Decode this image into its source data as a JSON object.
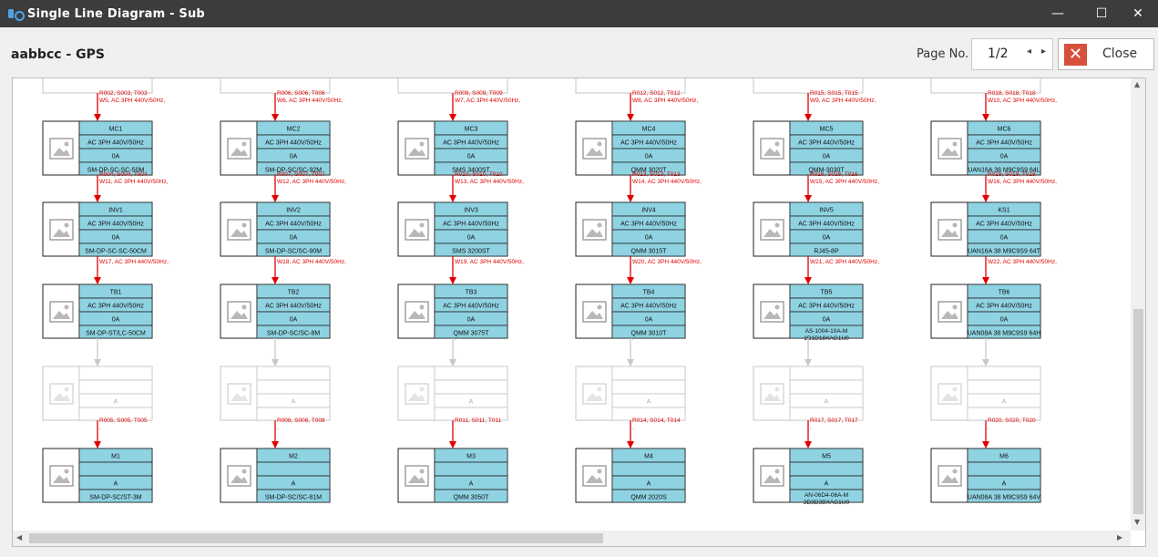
{
  "window": {
    "title": "Single Line Diagram - Sub",
    "minimize_glyph": "—",
    "maximize_glyph": "☐",
    "close_glyph": "✕"
  },
  "header": {
    "title": "aabbcc - GPS",
    "page_label": "Page No.",
    "page_value": "1/2",
    "prev_glyph": "◂",
    "next_glyph": "▸",
    "close_label": "Close"
  },
  "icons": {
    "app": "diagram-app-icon",
    "placeholder": "image-placeholder-icon",
    "close": "close-x-icon"
  },
  "colors": {
    "cell": "#8fd3e2",
    "arrow_active": "#e00000",
    "arrow_inactive": "#c8c8c8",
    "close_accent": "#d7503c"
  },
  "columns": [
    {
      "top_stub": "",
      "rows": [
        {
          "link": [
            "R002, S003, T003",
            "W5, AC 3PH 440V/50Hz,"
          ],
          "name": "MC1",
          "cells": [
            "AC 3PH 440V/50Hz",
            "0A",
            "SM-DP-SC-SC-50M"
          ]
        },
        {
          "link": [
            "R004, S004, T004",
            "W11, AC 3PH 440V/50Hz,"
          ],
          "name": "INV1",
          "cells": [
            "AC 3PH 440V/50Hz",
            "0A",
            "SM-DP-SC-SC-50CM"
          ]
        },
        {
          "link": [
            "W17, AC 3PH 440V/50Hz,"
          ],
          "name": "TB1",
          "cells": [
            "AC 3PH 440V/50Hz",
            "0A",
            "SM-DP-ST/LC-50CM"
          ]
        },
        {
          "inactive": true,
          "link": [
            "."
          ],
          "name": "",
          "cells": [
            "",
            "A",
            ""
          ]
        },
        {
          "link": [
            "R005, S005, T005",
            "."
          ],
          "name": "M1",
          "cells": [
            "",
            "A",
            "SM-DP-SC/ST-3M"
          ]
        }
      ]
    },
    {
      "rows": [
        {
          "link": [
            "R006, S006, T006",
            "W6, AC 3PH 440V/50Hz,"
          ],
          "name": "MC2",
          "cells": [
            "AC 3PH 440V/50Hz",
            "0A",
            "SM-DP-SC/SC-92M"
          ]
        },
        {
          "link": [
            "R007, S007, T007",
            "W12, AC 3PH 440V/50Hz,"
          ],
          "name": "INV2",
          "cells": [
            "AC 3PH 440V/50Hz",
            "0A",
            "SM-DP-SC/SC-90M"
          ]
        },
        {
          "link": [
            "W18, AC 3PH 440V/50Hz,"
          ],
          "name": "TB2",
          "cells": [
            "AC 3PH 440V/50Hz",
            "0A",
            "SM-DP-SC/SC-8M"
          ]
        },
        {
          "inactive": true,
          "link": [
            "."
          ],
          "name": "",
          "cells": [
            "",
            "A",
            ""
          ]
        },
        {
          "link": [
            "R008, S008, T008",
            "."
          ],
          "name": "M2",
          "cells": [
            "",
            "A",
            "SM-DP-SC/SC-81M"
          ]
        }
      ]
    },
    {
      "rows": [
        {
          "link": [
            "R009, S009, T009",
            "W7, AC 3PH 440V/50Hz,"
          ],
          "name": "MC3",
          "cells": [
            "AC 3PH 440V/50Hz",
            "0A",
            "SMS 3400ST"
          ]
        },
        {
          "link": [
            "R010, S010, T010",
            "W13, AC 3PH 440V/50Hz,"
          ],
          "name": "INV3",
          "cells": [
            "AC 3PH 440V/50Hz",
            "0A",
            "SMS 3200ST"
          ]
        },
        {
          "link": [
            "W19, AC 3PH 440V/50Hz,"
          ],
          "name": "TB3",
          "cells": [
            "AC 3PH 440V/50Hz",
            "0A",
            "QMM 3075T"
          ]
        },
        {
          "inactive": true,
          "link": [
            "."
          ],
          "name": "",
          "cells": [
            "",
            "A",
            ""
          ]
        },
        {
          "link": [
            "R011, S011, T011",
            "."
          ],
          "name": "M3",
          "cells": [
            "",
            "A",
            "QMM 3050T"
          ]
        }
      ]
    },
    {
      "rows": [
        {
          "link": [
            "R012, S012, T012",
            "W8, AC 3PH 440V/50Hz,"
          ],
          "name": "MC4",
          "cells": [
            "AC 3PH 440V/50Hz",
            "0A",
            "QMM 3020T"
          ]
        },
        {
          "link": [
            "R013, S013, T013",
            "W14, AC 3PH 440V/50Hz,"
          ],
          "name": "INV4",
          "cells": [
            "AC 3PH 440V/50Hz",
            "0A",
            "QMM 3015T"
          ]
        },
        {
          "link": [
            "W20, AC 3PH 440V/50Hz,"
          ],
          "name": "TB4",
          "cells": [
            "AC 3PH 440V/50Hz",
            "0A",
            "QMM 3010T"
          ]
        },
        {
          "inactive": true,
          "link": [
            "."
          ],
          "name": "",
          "cells": [
            "",
            "A",
            ""
          ]
        },
        {
          "link": [
            "R014, S014, T014",
            "."
          ],
          "name": "M4",
          "cells": [
            "",
            "A",
            "QMM 2020S"
          ]
        }
      ]
    },
    {
      "rows": [
        {
          "link": [
            "R015, S015, T015",
            "W9, AC 3PH 440V/50Hz,"
          ],
          "name": "MC5",
          "cells": [
            "AC 3PH 440V/50Hz",
            "0A",
            "QMM-3030T"
          ]
        },
        {
          "link": [
            "R016, S016, T016",
            "W15, AC 3PH 440V/50Hz,"
          ],
          "name": "INV5",
          "cells": [
            "AC 3PH 440V/50Hz",
            "0A",
            "RJ45-8P"
          ]
        },
        {
          "link": [
            "W21, AC 3PH 440V/50Hz,"
          ],
          "name": "TB5",
          "cells": [
            "AC 3PH 440V/50Hz",
            "0A",
            "AS-1004-10A-M1D1D18XAG1U0"
          ]
        },
        {
          "inactive": true,
          "link": [
            "."
          ],
          "name": "",
          "cells": [
            "",
            "A",
            ""
          ]
        },
        {
          "link": [
            "R017, S017, T017",
            "."
          ],
          "name": "M5",
          "cells": [
            "",
            "A",
            "AN-06D4-06A-M3D3D3BXAG1U0"
          ]
        }
      ]
    },
    {
      "rows": [
        {
          "link": [
            "R018, S018, T018",
            "W10, AC 3PH 440V/50Hz,"
          ],
          "name": "MC6",
          "cells": [
            "AC 3PH 440V/50Hz",
            "0A",
            "UAN16A 38 M9C9S9 64L"
          ]
        },
        {
          "link": [
            "R019, S019, T019",
            "W16, AC 3PH 440V/50Hz,"
          ],
          "name": "KS1",
          "cells": [
            "AC 3PH 440V/50Hz",
            "0A",
            "UAN16A 38 M9C9S9 64T"
          ]
        },
        {
          "link": [
            "W22, AC 3PH 440V/50Hz,"
          ],
          "name": "TB6",
          "cells": [
            "AC 3PH 440V/50Hz",
            "0A",
            "UAN08A 38 M9C9S9 64H"
          ]
        },
        {
          "inactive": true,
          "link": [
            "."
          ],
          "name": "",
          "cells": [
            "",
            "A",
            ""
          ]
        },
        {
          "link": [
            "R020, S020, T020",
            "."
          ],
          "name": "M6",
          "cells": [
            "",
            "A",
            "UAN08A 38 M9C9S9 64V"
          ]
        }
      ]
    }
  ],
  "scrollbars": {
    "up_glyph": "▲",
    "down_glyph": "▼",
    "left_glyph": "◀",
    "right_glyph": "▶"
  }
}
